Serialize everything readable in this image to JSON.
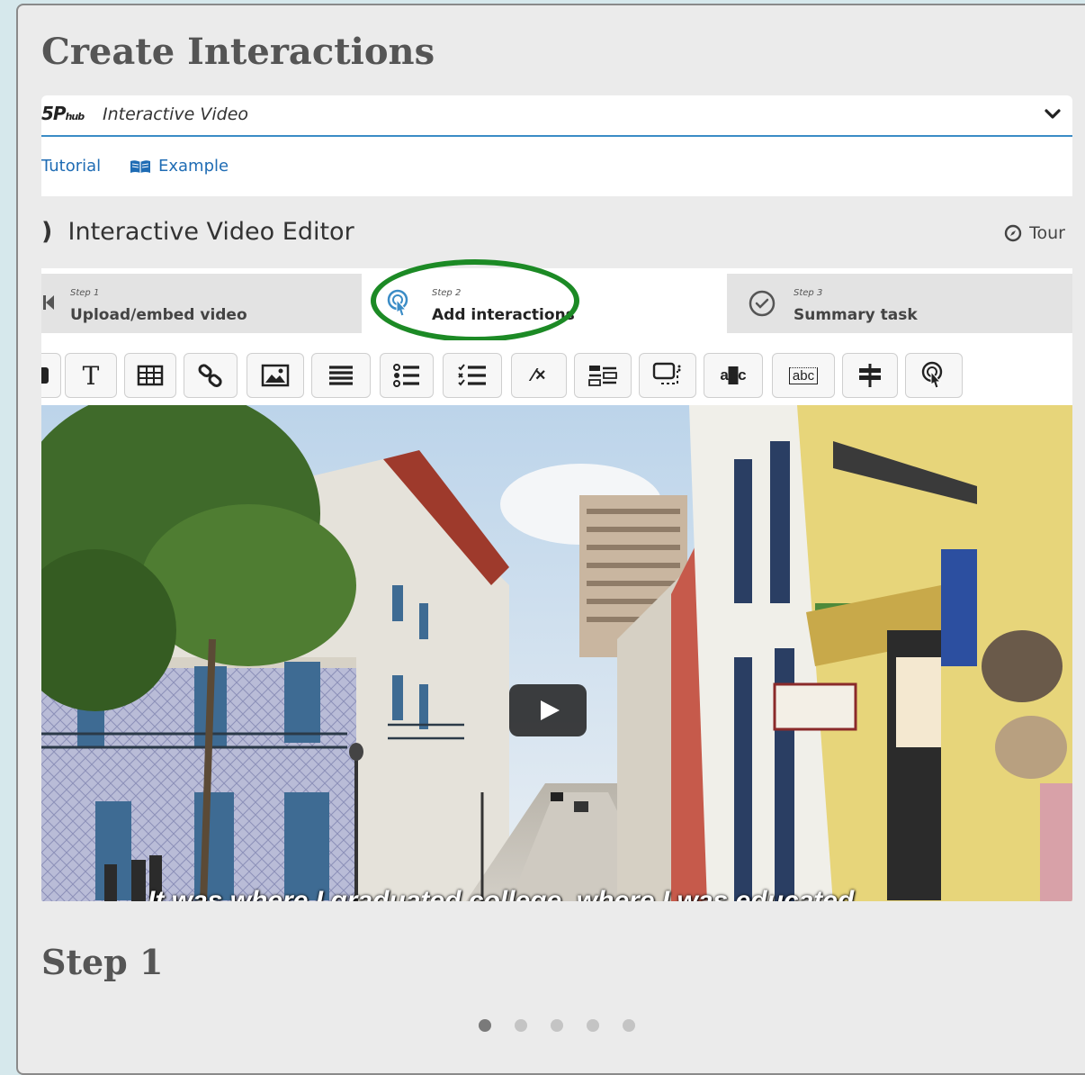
{
  "panel": {
    "title": "Create Interactions"
  },
  "hub": {
    "logo_main": "5P",
    "logo_sub": "hub",
    "content_type": "Interactive Video",
    "links": {
      "tutorial": "Tutorial",
      "example": "Example"
    }
  },
  "editor": {
    "title": "Interactive Video Editor",
    "tour": "Tour",
    "steps": [
      {
        "num": "Step 1",
        "label": "Upload/embed video",
        "icon": "skip-back-icon"
      },
      {
        "num": "Step 2",
        "label": "Add interactions",
        "icon": "touch-interaction-icon"
      },
      {
        "num": "Step 3",
        "label": "Summary task",
        "icon": "check-circle-icon"
      }
    ],
    "active_step": 2,
    "toolbar_tools": [
      "label-icon",
      "text-icon",
      "table-icon",
      "link-icon",
      "image-icon",
      "statements-icon",
      "single-choice-icon",
      "multiple-choice-icon",
      "true-false-icon",
      "drag-text-icon",
      "crossroads-icon",
      "mark-words-icon",
      "fill-blanks-icon",
      "navigation-hotspot-icon",
      "go-to-question-icon"
    ],
    "toolbar_glyph": {
      "text": "T",
      "true_false": "⁄×",
      "mark_words": "abc",
      "fill_blanks": "abc"
    }
  },
  "video": {
    "caption": "It was where I graduated college, where I was educated"
  },
  "section": {
    "heading": "Step 1"
  },
  "carousel": {
    "count": 5,
    "active": 1
  },
  "colors": {
    "accent": "#1f6cb4",
    "highlight": "#1c8a25",
    "title": "#555555"
  }
}
